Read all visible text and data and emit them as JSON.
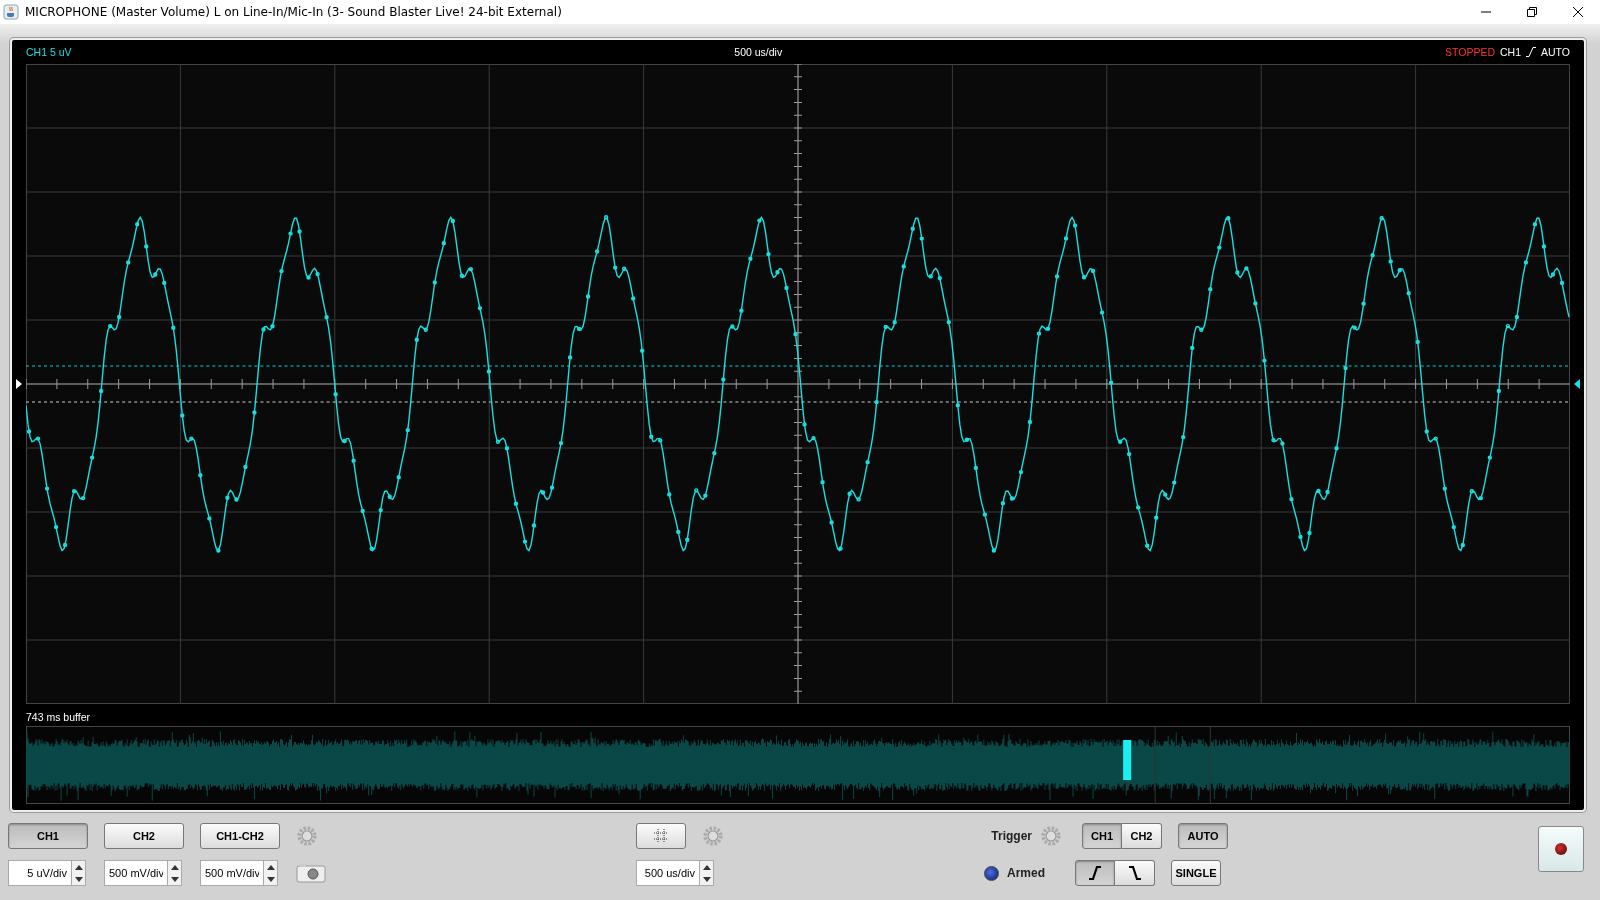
{
  "window": {
    "title": "MICROPHONE (Master Volume) L on Line-In/Mic-In (3- Sound Blaster Live! 24-bit External)"
  },
  "scope": {
    "channel_scale": "CH1 5 uV",
    "timebase": "500 us/div",
    "status": "STOPPED",
    "trigger_channel": "CH1",
    "trigger_mode": "AUTO",
    "buffer_label": "743 ms buffer"
  },
  "channel_buttons": [
    {
      "label": "CH1",
      "selected": true
    },
    {
      "label": "CH2",
      "selected": false
    },
    {
      "label": "CH1-CH2",
      "selected": false
    }
  ],
  "channel_scales": [
    {
      "value": "5 uV/div"
    },
    {
      "value": "500 mV/div"
    },
    {
      "value": "500 mV/div"
    }
  ],
  "timebase_field": {
    "value": "500 us/div"
  },
  "trigger": {
    "label": "Trigger",
    "armed_label": "Armed",
    "armed": true,
    "sources": [
      {
        "label": "CH1",
        "selected": true
      },
      {
        "label": "CH2",
        "selected": false
      }
    ],
    "slopes": [
      {
        "kind": "rising",
        "selected": true
      },
      {
        "kind": "falling",
        "selected": false
      }
    ],
    "modes": [
      {
        "label": "AUTO",
        "selected": true
      },
      {
        "label": "SINGLE",
        "selected": false
      }
    ]
  }
}
